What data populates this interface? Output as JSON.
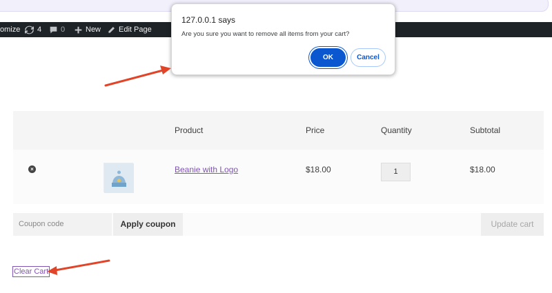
{
  "admin_bar": {
    "customize": "omize",
    "updates_count": "4",
    "comments_count": "0",
    "new_label": "New",
    "edit_label": "Edit Page"
  },
  "cart": {
    "columns": [
      "",
      "",
      "Product",
      "Price",
      "Quantity",
      "Subtotal"
    ],
    "items": [
      {
        "remove_icon": "remove-icon",
        "thumbnail": "beanie-thumbnail",
        "product": "Beanie with Logo",
        "price": "$18.00",
        "quantity": "1",
        "subtotal": "$18.00"
      }
    ],
    "coupon_placeholder": "Coupon code",
    "apply_coupon_label": "Apply coupon",
    "update_cart_label": "Update cart",
    "clear_cart_label": "Clear Cart"
  },
  "dialog": {
    "title": "127.0.0.1 says",
    "message": "Are you sure you want to remove all items from your cart?",
    "ok_label": "OK",
    "cancel_label": "Cancel"
  },
  "colors": {
    "annotation_arrow": "#e0452a",
    "link_purple": "#7f54b3",
    "dialog_primary": "#0b57d0",
    "admin_bar_bg": "#1d2327"
  }
}
